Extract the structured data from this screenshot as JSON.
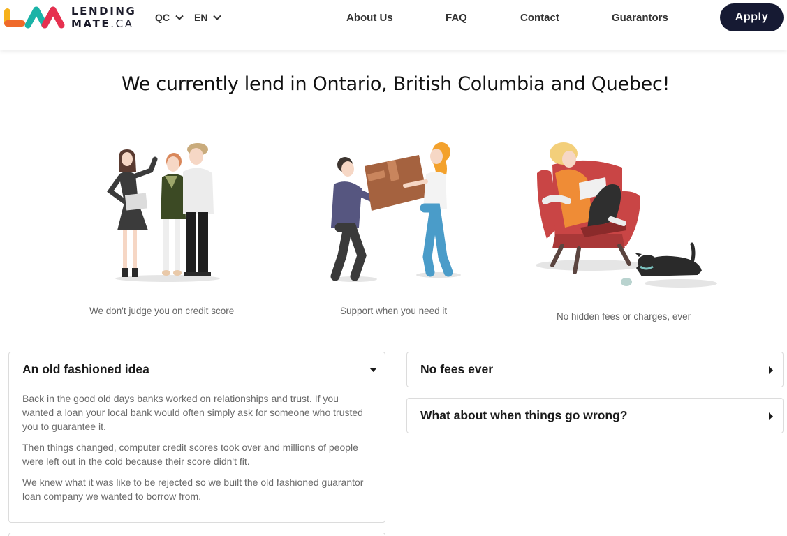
{
  "brand": {
    "name_main": "LENDING",
    "name_sub": "MATE",
    "name_tld": ".CA",
    "colors": {
      "yellow": "#f6b21b",
      "orange": "#ef6a2a",
      "red": "#e6304f",
      "teal": "#1bb3a7",
      "navy": "#161a33"
    }
  },
  "header": {
    "region_selector": "QC",
    "language_selector": "EN",
    "nav": {
      "about": "About Us",
      "faq": "FAQ",
      "contact": "Contact",
      "guarantors": "Guarantors"
    },
    "apply_label": "Apply"
  },
  "headline": "We currently lend in Ontario, British Columbia and Quebec!",
  "features": [
    {
      "caption": "We don't judge you on credit score",
      "icon": "people-illustration"
    },
    {
      "caption": "Support when you need it",
      "icon": "moving-box-illustration"
    },
    {
      "caption": "No hidden fees or charges, ever",
      "icon": "armchair-reading-illustration"
    }
  ],
  "accordions": {
    "left": {
      "title": "An old fashioned idea",
      "state": "expanded",
      "paragraphs": [
        "Back in the good old days banks worked on relationships and trust. If you wanted a loan your local bank would often simply ask for someone who trusted you to guarantee it.",
        "Then things changed, computer credit scores took over and millions of people were left out in the cold because their score didn't fit.",
        "We knew what it was like to be rejected so we built the old fashioned guarantor loan company we wanted to borrow from."
      ]
    },
    "right": [
      {
        "title": "No fees ever",
        "state": "collapsed"
      },
      {
        "title": "What about when things go wrong?",
        "state": "collapsed"
      }
    ]
  }
}
